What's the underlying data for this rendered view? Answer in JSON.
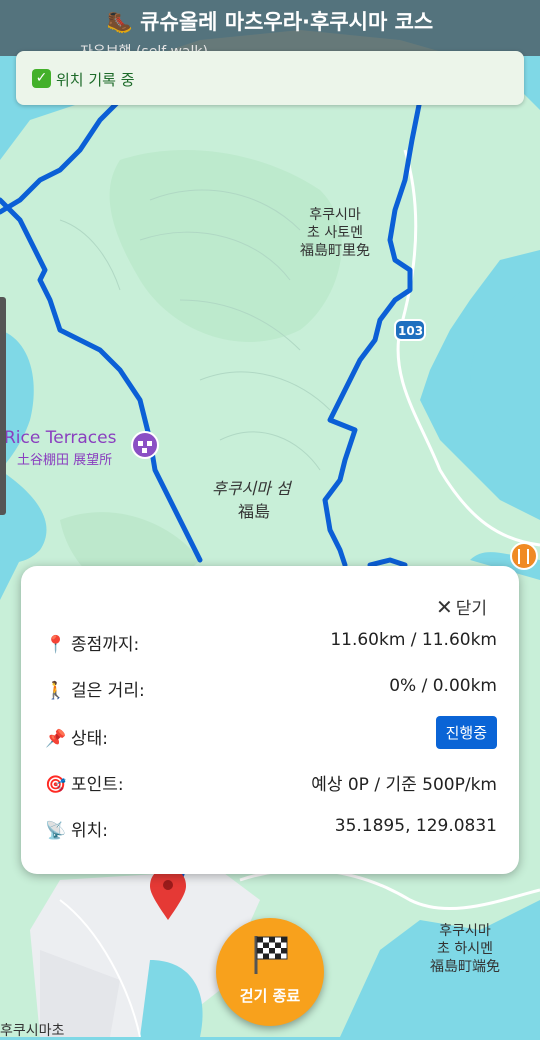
{
  "header": {
    "title": "🥾 큐슈올레 마츠우라·후쿠시마 코스",
    "subtitle": "자유보행 (self-walk)"
  },
  "banner": {
    "text": "위치 기록 중",
    "icon": "check-icon"
  },
  "map": {
    "labels": {
      "town_north": [
        "후쿠시마",
        "초 사토멘",
        "福島町里免"
      ],
      "road": "103",
      "poi_terraces_en": "Rice Terraces",
      "poi_terraces_jp": "土谷棚田 展望所",
      "island_ko": "후쿠시마 섬",
      "island_jp": "福島",
      "town_south": [
        "후쿠시마",
        "초 하시멘",
        "福島町端免"
      ],
      "bottom_left": "후쿠시마초"
    },
    "colors": {
      "water": "#7fd8e6",
      "land": "#c8efd8",
      "route": "#0b5fd6"
    }
  },
  "panel": {
    "close_label": "닫기",
    "rows": [
      {
        "icon": "📍",
        "label": "종점까지:",
        "value": "11.60km / 11.60km"
      },
      {
        "icon": "🚶",
        "label": "걸은 거리:",
        "value": "0% / 0.00km"
      },
      {
        "icon": "📌",
        "label": "상태:",
        "value": "진행중"
      },
      {
        "icon": "🎯",
        "label": "포인트:",
        "value": "예상 0P / 기준 500P/km"
      },
      {
        "icon": "📡",
        "label": "위치:",
        "value": "35.1895, 129.0831"
      }
    ]
  },
  "end_button": {
    "label": "걷기 종료",
    "icon": "checkered-flag-icon"
  }
}
